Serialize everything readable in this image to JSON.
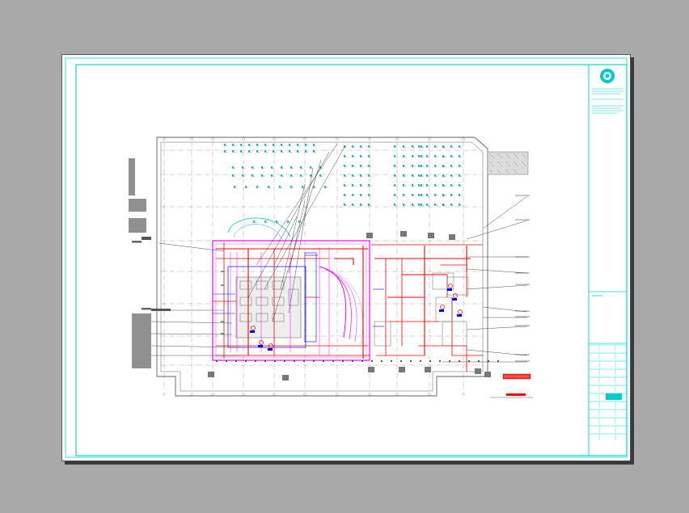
{
  "drawing": {
    "title_block": {
      "logo_icon": "firm-logo-icon",
      "rows": 12
    },
    "colors": {
      "background": "#a9a9a9",
      "paper": "#ffffff",
      "frame": "#00e5e5",
      "wall": "#606060",
      "pipe_red": "#ff0000",
      "pipe_magenta": "#ff00ff",
      "pipe_blue": "#0000ff",
      "fixture_cyan": "#00cccc",
      "legend_red": "#ff0000"
    },
    "icons": [
      "firm-logo-icon",
      "north-hatch-icon"
    ]
  }
}
